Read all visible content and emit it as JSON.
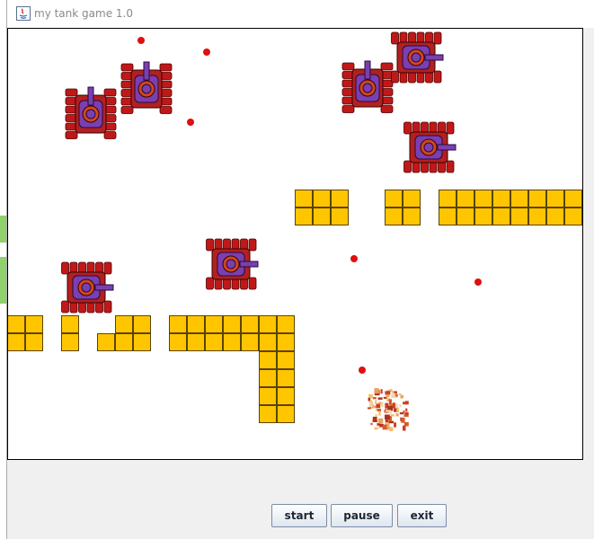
{
  "window": {
    "title": "my tank game 1.0"
  },
  "colors": {
    "brick": "#ffc600",
    "bullet": "#e01010",
    "tank_tread": "#c01818",
    "tank_body": "#7a3fb0",
    "canvas": "#ffffff"
  },
  "controls": {
    "start_label": "start",
    "pause_label": "pause",
    "exit_label": "exit"
  }
}
